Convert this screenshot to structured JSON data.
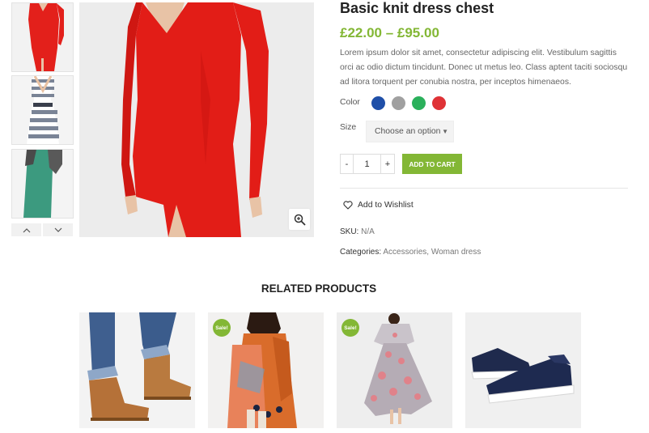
{
  "product": {
    "title": "Basic knit dress chest",
    "price": "£22.00 – £95.00",
    "description": "Lorem ipsum dolor sit amet, consectetur adipiscing elit. Vestibulum sagittis orci ac odio dictum tincidunt. Donec ut metus leo. Class aptent taciti sociosqu ad litora torquent per conubia nostra, per inceptos himenaeos."
  },
  "gallery": {
    "thumbnails": [
      "red-dress-thumbnail",
      "striped-dress-thumbnail",
      "green-dress-thumbnail"
    ],
    "main_image": "red-dress-photo"
  },
  "options": {
    "color_label": "Color",
    "colors": [
      "#1f4fa8",
      "#a0a0a0",
      "#2bb05b",
      "#df3236"
    ],
    "size_label": "Size",
    "size_placeholder": "Choose an option"
  },
  "cart": {
    "minus": "-",
    "quantity": "1",
    "plus": "+",
    "add_to_cart": "ADD TO CART"
  },
  "wishlist": {
    "label": "Add to Wishlist"
  },
  "meta": {
    "sku_label": "SKU:",
    "sku_value": "N/A",
    "categories_label": "Categories:",
    "categories": [
      "Accessories",
      "Woman dress"
    ],
    "separator": ", "
  },
  "related": {
    "title": "RELATED PRODUCTS",
    "items": [
      {
        "image": "boots-on-jeans",
        "sale": false
      },
      {
        "image": "orange-printed-outfit",
        "sale": true,
        "badge": "Sale!"
      },
      {
        "image": "floral-dress",
        "sale": true,
        "badge": "Sale!"
      },
      {
        "image": "navy-sneakers",
        "sale": false
      }
    ]
  },
  "colors": {
    "accent": "#83b735"
  }
}
